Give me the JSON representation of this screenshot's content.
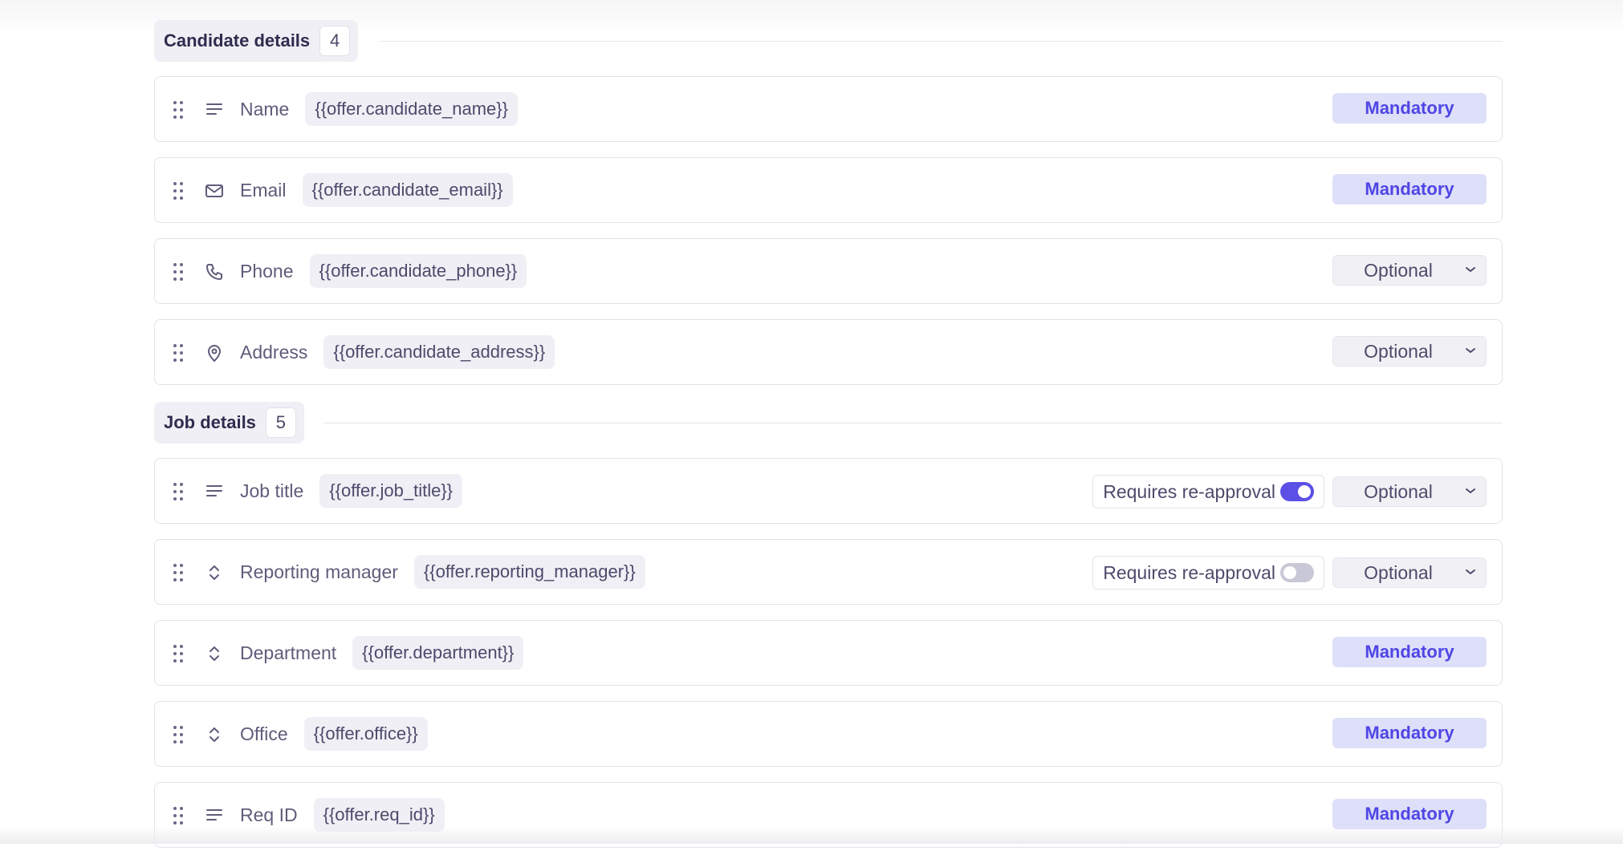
{
  "sections": [
    {
      "title": "Candidate details",
      "count": "4",
      "fields": [
        {
          "label": "Name",
          "token": "{{offer.candidate_name}}",
          "icon": "text-lines-icon",
          "requirement": "Mandatory"
        },
        {
          "label": "Email",
          "token": "{{offer.candidate_email}}",
          "icon": "mail-icon",
          "requirement": "Mandatory"
        },
        {
          "label": "Phone",
          "token": "{{offer.candidate_phone}}",
          "icon": "phone-icon",
          "requirement": "Optional"
        },
        {
          "label": "Address",
          "token": "{{offer.candidate_address}}",
          "icon": "map-pin-icon",
          "requirement": "Optional"
        }
      ]
    },
    {
      "title": "Job details",
      "count": "5",
      "fields": [
        {
          "label": "Job title",
          "token": "{{offer.job_title}}",
          "icon": "text-lines-icon",
          "requirement": "Optional",
          "reapproval_label": "Requires re-approval",
          "reapproval_on": true
        },
        {
          "label": "Reporting manager",
          "token": "{{offer.reporting_manager}}",
          "icon": "chevron-up-down-icon",
          "requirement": "Optional",
          "reapproval_label": "Requires re-approval",
          "reapproval_on": false
        },
        {
          "label": "Department",
          "token": "{{offer.department}}",
          "icon": "chevron-up-down-icon",
          "requirement": "Mandatory"
        },
        {
          "label": "Office",
          "token": "{{offer.office}}",
          "icon": "chevron-up-down-icon",
          "requirement": "Mandatory"
        },
        {
          "label": "Req ID",
          "token": "{{offer.req_id}}",
          "icon": "text-lines-icon",
          "requirement": "Mandatory"
        }
      ]
    }
  ],
  "colors": {
    "accent": "#4f46e5",
    "mandatory_bg": "#dedff9",
    "toggle_on": "#5b4fe6",
    "toggle_off": "#c9c8d6"
  }
}
